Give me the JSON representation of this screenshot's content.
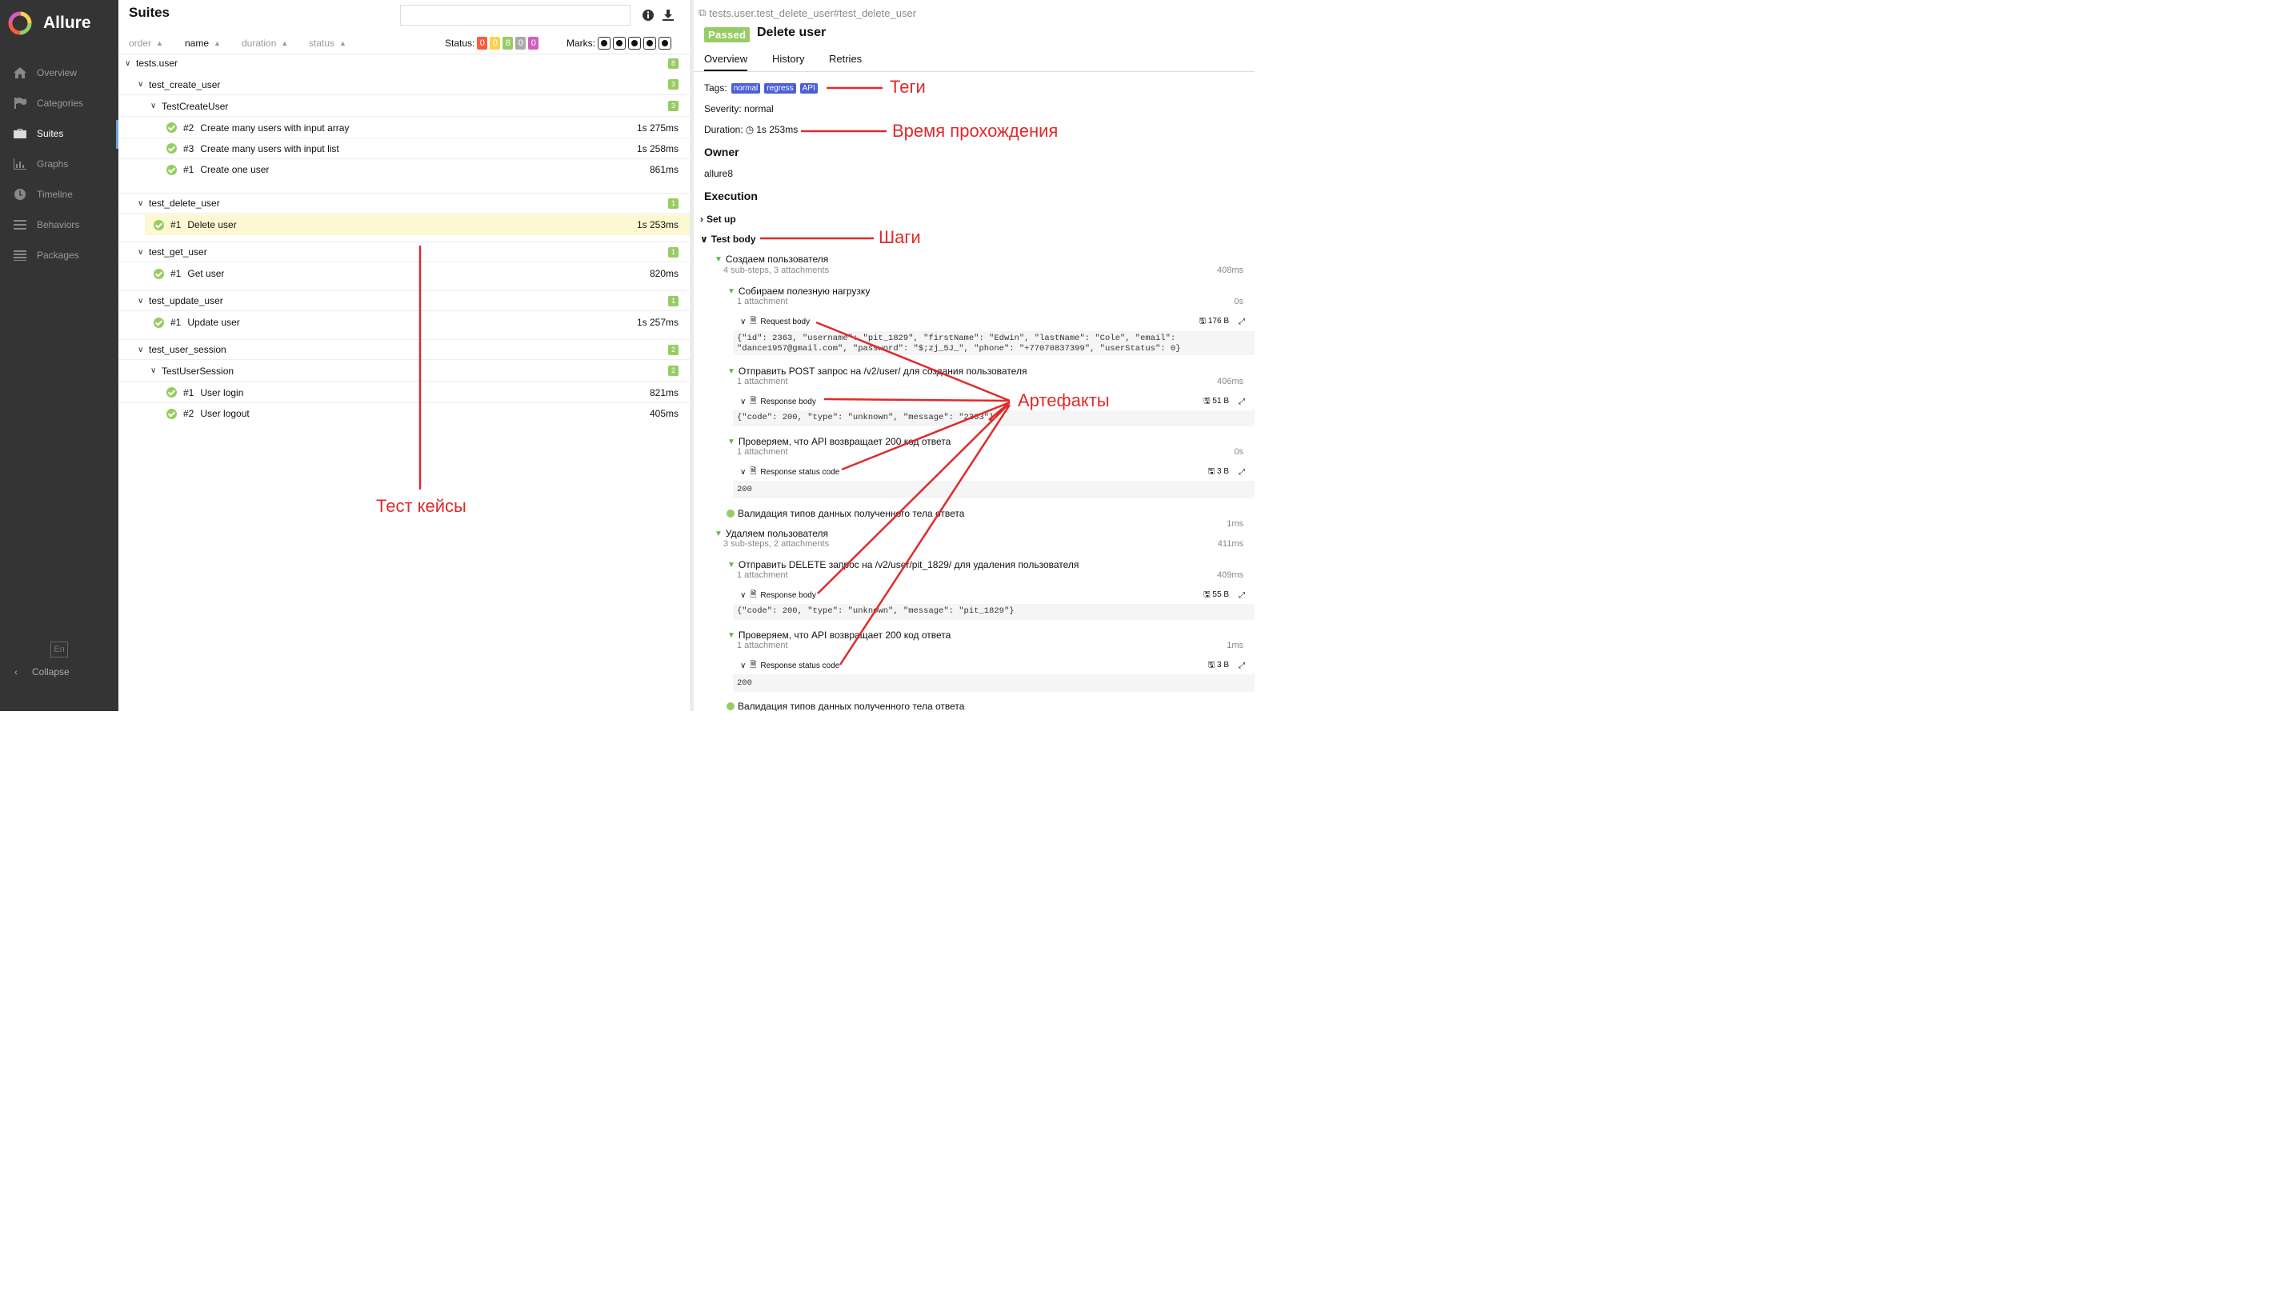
{
  "app": {
    "name": "Allure"
  },
  "sidebar": {
    "items": [
      {
        "label": "Overview",
        "icon": "home-icon"
      },
      {
        "label": "Categories",
        "icon": "flag-icon"
      },
      {
        "label": "Suites",
        "icon": "briefcase-icon"
      },
      {
        "label": "Graphs",
        "icon": "bar-chart-icon"
      },
      {
        "label": "Timeline",
        "icon": "clock-icon"
      },
      {
        "label": "Behaviors",
        "icon": "list-icon"
      },
      {
        "label": "Packages",
        "icon": "stack-icon"
      }
    ],
    "active": "Suites",
    "lang": "En",
    "collapse": "Collapse"
  },
  "suites": {
    "title": "Suites",
    "search": {
      "value": "",
      "placeholder": ""
    },
    "sort": {
      "order": "order",
      "name": "name",
      "duration": "duration",
      "status": "status"
    },
    "status_label": "Status:",
    "status_counts": [
      {
        "value": "0",
        "color": "#fd5a3e"
      },
      {
        "value": "0",
        "color": "#ffd050"
      },
      {
        "value": "8",
        "color": "#97cc64"
      },
      {
        "value": "0",
        "color": "#aaaaaa"
      },
      {
        "value": "0",
        "color": "#d35ebe"
      }
    ],
    "marks_label": "Marks:",
    "tree": {
      "root": {
        "name": "tests.user",
        "count": "8"
      },
      "groups": [
        {
          "name": "test_create_user",
          "count": "3",
          "class": "TestCreateUser",
          "class_count": "3",
          "tests": [
            {
              "num": "#2",
              "name": "Create many users with input array",
              "duration": "1s 275ms"
            },
            {
              "num": "#3",
              "name": "Create many users with input list",
              "duration": "1s 258ms"
            },
            {
              "num": "#1",
              "name": "Create one user",
              "duration": "861ms"
            }
          ]
        },
        {
          "name": "test_delete_user",
          "count": "1",
          "tests": [
            {
              "num": "#1",
              "name": "Delete user",
              "duration": "1s 253ms"
            }
          ]
        },
        {
          "name": "test_get_user",
          "count": "1",
          "tests": [
            {
              "num": "#1",
              "name": "Get user",
              "duration": "820ms"
            }
          ]
        },
        {
          "name": "test_update_user",
          "count": "1",
          "tests": [
            {
              "num": "#1",
              "name": "Update user",
              "duration": "1s 257ms"
            }
          ]
        },
        {
          "name": "test_user_session",
          "count": "2",
          "class": "TestUserSession",
          "class_count": "2",
          "tests": [
            {
              "num": "#1",
              "name": "User login",
              "duration": "821ms"
            },
            {
              "num": "#2",
              "name": "User logout",
              "duration": "405ms"
            }
          ]
        }
      ]
    }
  },
  "details": {
    "breadcrumb": "tests.user.test_delete_user#test_delete_user",
    "status": "Passed",
    "title": "Delete user",
    "tabs": [
      "Overview",
      "History",
      "Retries"
    ],
    "tags_label": "Tags:",
    "tags": [
      "normal",
      "regress",
      "API"
    ],
    "severity": "Severity: normal",
    "duration_label": "Duration:",
    "duration": "1s 253ms",
    "owner_h": "Owner",
    "owner": "allure8",
    "execution_h": "Execution",
    "setup": "Set up",
    "body": "Test body",
    "steps": {
      "s1": {
        "name": "Создаем пользователя",
        "sub": "4 sub-steps, 3 attachments",
        "dur": "408ms"
      },
      "s1a": {
        "name": "Собираем полезную нагрузку",
        "sub": "1 attachment",
        "dur": "0s",
        "att": "Request body",
        "size": "176 B",
        "code1": "{\"id\": 2363, \"username\": \"pit_1829\", \"firstName\": \"Edwin\", \"lastName\": \"Cole\", \"email\":",
        "code2": "\"dance1957@gmail.com\", \"password\": \"$;zj_5J_\", \"phone\": \"+77070837399\", \"userStatus\": 0}"
      },
      "s1b": {
        "name": "Отправить POST запрос на /v2/user/ для создания пользователя",
        "sub": "1 attachment",
        "dur": "406ms",
        "att": "Response body",
        "size": "51 B",
        "code1": "{\"code\": 200, \"type\": \"unknown\", \"message\": \"2363\"}"
      },
      "s1c": {
        "name": "Проверяем, что API возвращает 200 код ответа",
        "sub": "1 attachment",
        "dur": "0s",
        "att": "Response status code",
        "size": "3 B",
        "code1": "200"
      },
      "s1d": {
        "name": "Валидация типов данных полученного тела ответа",
        "dur": "1ms"
      },
      "s2": {
        "name": "Удаляем пользователя",
        "sub": "3 sub-steps, 2 attachments",
        "dur": "411ms"
      },
      "s2a": {
        "name": "Отправить DELETE запрос на /v2/user/pit_1829/ для удаления пользователя",
        "sub": "1 attachment",
        "dur": "409ms",
        "att": "Response body",
        "size": "55 B",
        "code1": "{\"code\": 200, \"type\": \"unknown\", \"message\": \"pit_1829\"}"
      },
      "s2b": {
        "name": "Проверяем, что API возвращает 200 код ответа",
        "sub": "1 attachment",
        "dur": "1ms",
        "att": "Response status code",
        "size": "3 B",
        "code1": "200"
      },
      "s2c": {
        "name": "Валидация типов данных полученного тела ответа"
      }
    }
  },
  "annotations": {
    "tags": "Теги",
    "duration": "Время прохождения",
    "steps": "Шаги",
    "artifacts": "Артефакты",
    "testcases": "Тест кейсы",
    "color": "#e02a2a"
  }
}
